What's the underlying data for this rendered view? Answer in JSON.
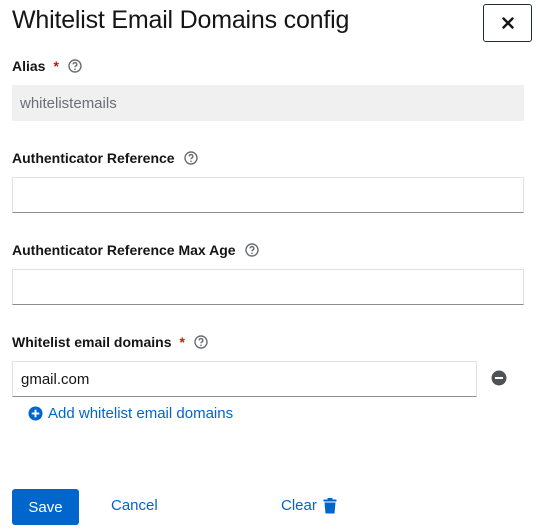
{
  "dialog": {
    "title": "Whitelist Email Domains config",
    "close_icon": "close-icon"
  },
  "colors": {
    "primary": "#0066cc",
    "required": "#c9190b",
    "text": "#151515"
  },
  "fields": {
    "alias": {
      "label": "Alias",
      "required_marker": "*",
      "value": "whitelistemails"
    },
    "auth_ref": {
      "label": "Authenticator Reference",
      "value": ""
    },
    "auth_ref_max_age": {
      "label": "Authenticator Reference Max Age",
      "value": ""
    },
    "whitelist_domains": {
      "label": "Whitelist email domains",
      "required_marker": "*",
      "values": [
        "gmail.com"
      ],
      "add_label": "Add whitelist email domains"
    }
  },
  "footer": {
    "save_label": "Save",
    "cancel_label": "Cancel",
    "clear_label": "Clear"
  }
}
